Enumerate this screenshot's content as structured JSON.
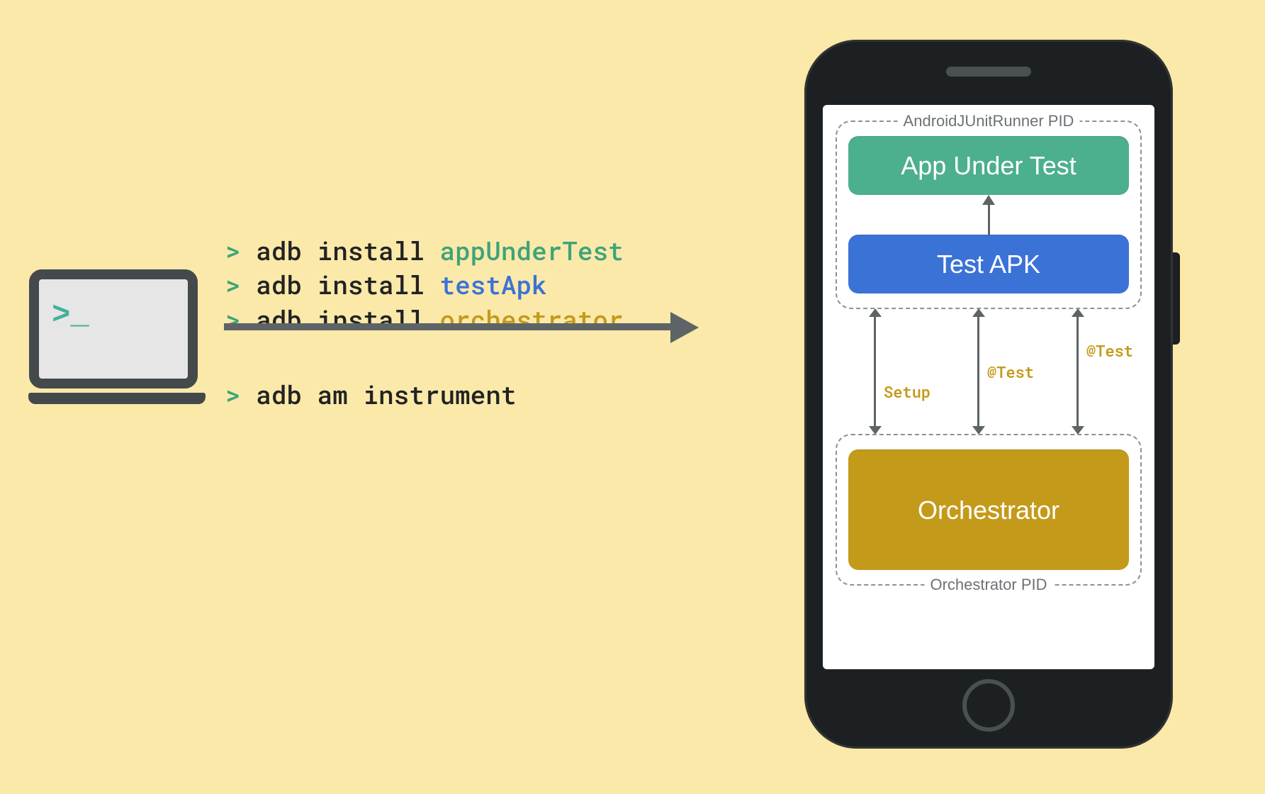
{
  "laptop": {
    "prompt": ">_"
  },
  "commands": {
    "line1_prompt": "> ",
    "line1_cmd": "adb install ",
    "line1_arg": "appUnderTest",
    "line2_prompt": "> ",
    "line2_cmd": "adb install ",
    "line2_arg": "testApk",
    "line3_prompt": "> ",
    "line3_cmd": "adb install ",
    "line3_arg": "orchestrator",
    "line4_prompt": "> ",
    "line4_cmd": "adb am instrument"
  },
  "phone": {
    "group_top_label": "AndroidJUnitRunner PID",
    "group_bottom_label": "Orchestrator PID",
    "app_box": "App Under Test",
    "test_box": "Test APK",
    "orch_box": "Orchestrator",
    "links": {
      "l1": "Setup",
      "l2": "@Test",
      "l3": "@Test"
    }
  },
  "colors": {
    "bg": "#fae9a9",
    "green": "#4caf8e",
    "blue": "#3b72d6",
    "gold": "#c49a1a",
    "dark": "#44494c"
  }
}
